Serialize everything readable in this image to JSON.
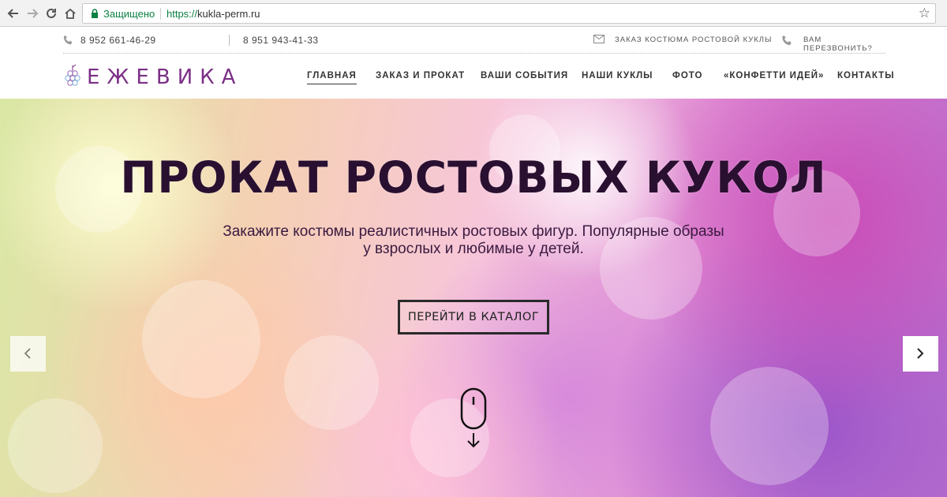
{
  "browser": {
    "secure_label": "Защищено",
    "url_scheme": "https://",
    "url_host": "kukla-perm.ru"
  },
  "topbar": {
    "phone1": "8 952 661-46-29",
    "phone2": "8 951 943-41-33",
    "order_link": "ЗАКАЗ КОСТЮМА РОСТОВОЙ КУКЛЫ",
    "callback_link": "ВАМ ПЕРЕЗВОНИТЬ?"
  },
  "logo": {
    "text": "ЕЖЕВИКА",
    "color": "#7b2f86"
  },
  "menu": {
    "items": [
      {
        "label": "ГЛАВНАЯ",
        "active": true
      },
      {
        "label": "ЗАКАЗ И ПРОКАТ"
      },
      {
        "label": "ВАШИ СОБЫТИЯ"
      },
      {
        "label": "НАШИ КУКЛЫ"
      },
      {
        "label": "ФОТО"
      },
      {
        "label": "«КОНФЕТТИ ИДЕЙ»"
      },
      {
        "label": "КОНТАКТЫ"
      }
    ]
  },
  "hero": {
    "title": "ПРОКАТ РОСТОВЫХ КУКОЛ",
    "subtitle_line1": "Закажите костюмы реалистичных ростовых фигур. Популярные образы",
    "subtitle_line2": "у взрослых и любимые у детей.",
    "cta_label": "ПЕРЕЙТИ В КАТАЛОГ"
  }
}
